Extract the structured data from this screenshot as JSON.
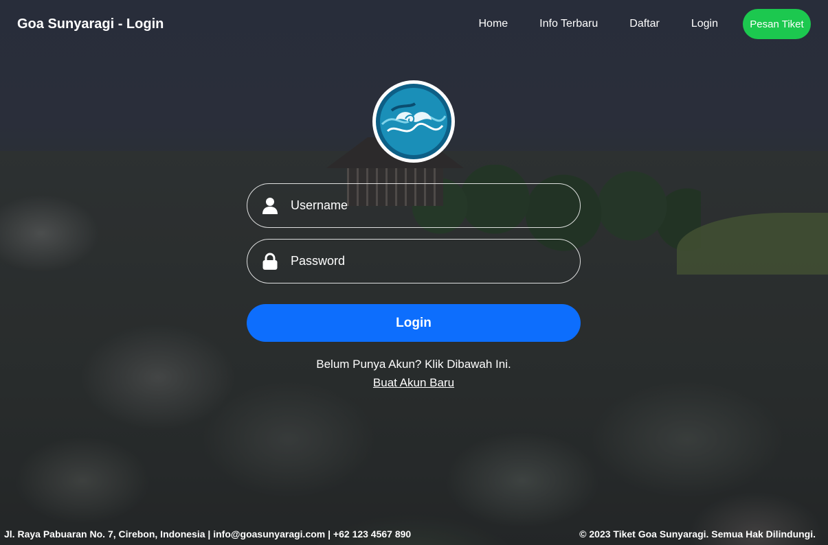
{
  "navbar": {
    "brand": "Goa Sunyaragi - Login",
    "links": [
      "Home",
      "Info Terbaru",
      "Daftar",
      "Login"
    ],
    "cta": "Pesan Tiket",
    "cta_color": "#1cc84f"
  },
  "logo": {
    "icon": "mega-mendung-logo"
  },
  "form": {
    "username_placeholder": "Username",
    "username_icon": "user-icon",
    "password_placeholder": "Password",
    "password_icon": "lock-icon",
    "submit_label": "Login",
    "submit_color": "#0d6efd",
    "hint": "Belum Punya Akun? Klik Dibawah Ini.",
    "signup_link": "Buat Akun Baru"
  },
  "footer": {
    "address": "Jl. Raya Pabuaran No. 7, Cirebon, Indonesia | info@goasunyaragi.com | +62 123 4567 890",
    "copyright": "© 2023 Tiket Goa Sunyaragi. Semua Hak Dilindungi."
  }
}
